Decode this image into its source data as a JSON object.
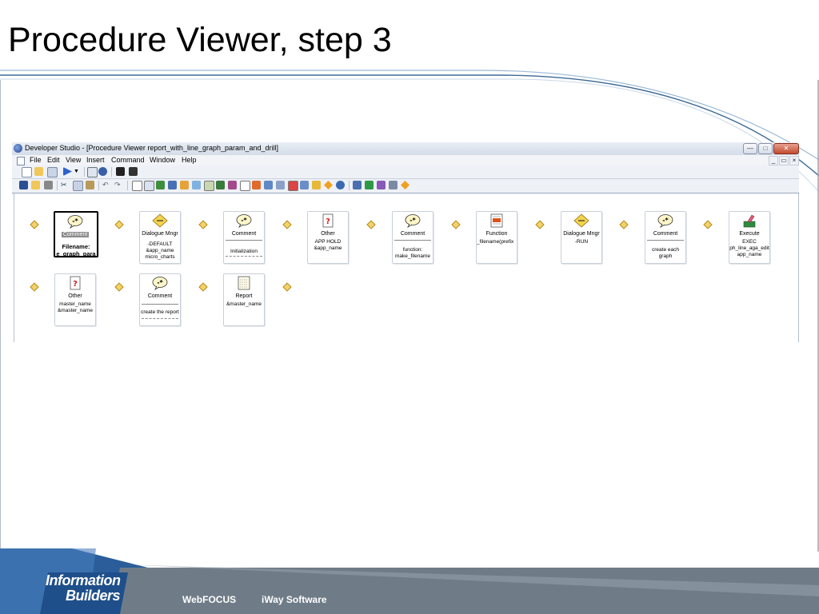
{
  "slide": {
    "title": "Procedure Viewer, step 3",
    "footer_brand_line1": "Information",
    "footer_brand_line2": "Builders",
    "footer_link1": "WebFOCUS",
    "footer_link2": "iWay Software"
  },
  "window": {
    "title": "Developer Studio - [Procedure Viewer report_with_line_graph_param_and_drill]",
    "menu": [
      "File",
      "Edit",
      "View",
      "Insert",
      "Command",
      "Window",
      "Help"
    ]
  },
  "nodes": [
    {
      "type": "Comment",
      "selected": true,
      "label": "Comment",
      "filename_label": "Filename:",
      "filename": "e_graph_para",
      "icon": "comment-icon"
    },
    {
      "type": "Dialogue Mngr",
      "label": "Dialogue Mngr",
      "body": "-DEFAULT\n&app_name\nmicro_charts",
      "icon": "dialogue-mngr-icon"
    },
    {
      "type": "Comment",
      "label": "Comment",
      "body": "Initialization",
      "icon": "comment-icon"
    },
    {
      "type": "Other",
      "label": "Other",
      "body": "APP HOLD\n&app_name",
      "icon": "other-icon"
    },
    {
      "type": "Comment",
      "label": "Comment",
      "body": "function:\nmake_filename",
      "icon": "comment-icon"
    },
    {
      "type": "Function",
      "label": "Function",
      "body": "_filename(prefix",
      "icon": "function-icon"
    },
    {
      "type": "Dialogue Mngr",
      "label": "Dialogue Mngr",
      "body": "-RUN",
      "icon": "dialogue-mngr-icon"
    },
    {
      "type": "Comment",
      "label": "Comment",
      "body": "create each\ngraph",
      "icon": "comment-icon"
    },
    {
      "type": "Execute",
      "label": "Execute",
      "body": "EXEC\nph_line_aga_edit\napp_name",
      "icon": "execute-icon"
    },
    {
      "type": "Other",
      "label": "Other",
      "body": "master_name\n&master_name",
      "icon": "other-icon"
    },
    {
      "type": "Comment",
      "label": "Comment",
      "body": "create the report",
      "icon": "comment-icon"
    },
    {
      "type": "Report",
      "label": "Report",
      "body": "&master_name",
      "icon": "report-icon"
    }
  ]
}
